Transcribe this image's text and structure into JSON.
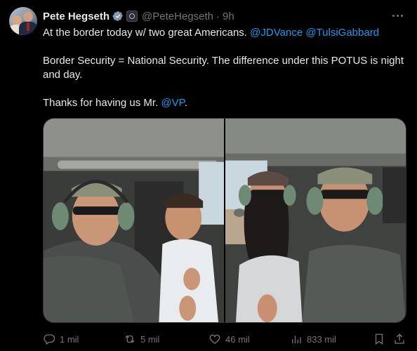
{
  "tweet": {
    "author_name": "Pete Hegseth",
    "author_handle": "@PeteHegseth",
    "separator": "·",
    "time": "9h",
    "text_line1_plain": "At the border today w/ two great Americans. ",
    "mention_1": "@JDVance",
    "mention_2": "@TulsiGabbard",
    "paragraph_2": "Border Security = National Security. The difference under this POTUS is night and day.",
    "paragraph_3_plain": "Thanks for having us Mr. ",
    "mention_3": "@VP",
    "paragraph_3_end": "."
  },
  "actions": {
    "replies": "1 mil",
    "reposts": "5 mil",
    "likes": "46 mil",
    "views": "833 mil"
  },
  "icons": [
    "verified-badge-icon",
    "affiliate-badge-icon",
    "more-icon",
    "reply-icon",
    "repost-icon",
    "like-icon",
    "views-icon",
    "bookmark-icon",
    "share-icon"
  ],
  "colors": {
    "background": "#000000",
    "text": "#e7e9ea",
    "muted": "#71767b",
    "link": "#1d9bf0"
  }
}
